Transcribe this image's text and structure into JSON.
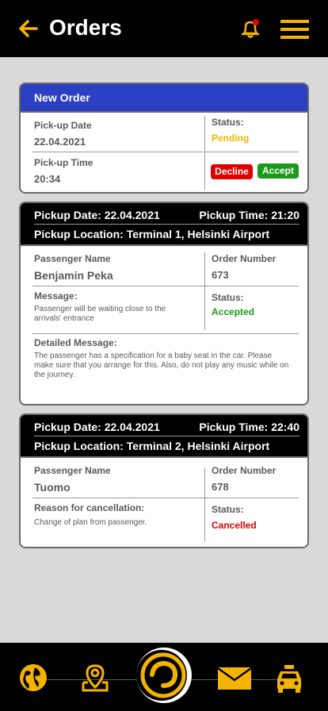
{
  "header": {
    "title": "Orders"
  },
  "new_order": {
    "heading": "New Order",
    "pickup_date_label": "Pick-up Date",
    "pickup_date": "22.04.2021",
    "pickup_time_label": "Pick-up Time",
    "pickup_time": "20:34",
    "status_label": "Status:",
    "status": "Pending",
    "decline_label": "Decline",
    "accept_label": "Accept"
  },
  "orders": [
    {
      "pickup_date_label": "Pickup Date:",
      "pickup_date": "22.04.2021",
      "pickup_time_label": "Pickup Time:",
      "pickup_time": "21:20",
      "location_label": "Pickup Location:",
      "location": "Terminal 1, Helsinki Airport",
      "passenger_label": "Passenger Name",
      "passenger": "Benjamin Peka",
      "order_number_label": "Order Number",
      "order_number": "673",
      "message_label": "Message:",
      "message": "Passenger will be waiting close to the arrivals' entrance",
      "status_label": "Status:",
      "status": "Accepted",
      "detail_label": "Detailed Message:",
      "detail": "The passenger has a specification for a baby seat in the car. Please make sure that you arrange for this. Also, do not play any music while on the journey."
    },
    {
      "pickup_date_label": "Pickup Date:",
      "pickup_date": "22.04.2021",
      "pickup_time_label": "Pickup Time:",
      "pickup_time": "22:40",
      "location_label": "Pickup Location:",
      "location": "Terminal 2, Helsinki Airport",
      "passenger_label": "Passenger Name",
      "passenger": "Tuomo",
      "order_number_label": "Order Number",
      "order_number": "678",
      "reason_label": "Reason for cancellation:",
      "reason": "Change of plan from passenger.",
      "status_label": "Status:",
      "status": "Cancelled"
    }
  ],
  "colors": {
    "accent": "#f5b301",
    "new_order_header": "#2a3fc2",
    "pending": "#f0b400",
    "accepted": "#1a9a1a",
    "cancelled": "#e00000"
  },
  "footer": {
    "icons": [
      "globe-icon",
      "map-pin-icon",
      "home-logo-icon",
      "mail-icon",
      "taxi-icon"
    ]
  }
}
